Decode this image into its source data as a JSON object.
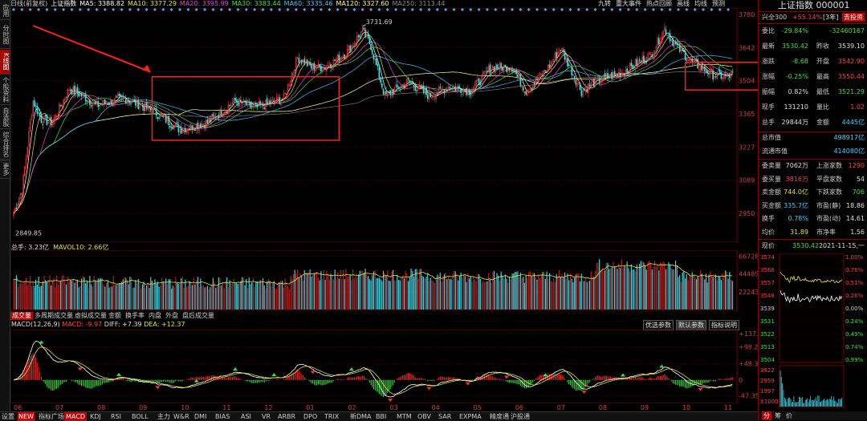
{
  "left_toolbar": [
    "应用",
    "分时图",
    "K线图",
    "个股资料",
    "自选股",
    "综合排名",
    "牛叉诊断",
    "更多"
  ],
  "legend": {
    "period": "日线(前复权)",
    "index_name": "上证指数",
    "ma5": "MA5: 3388.82",
    "ma10": "MA10: 3377.29",
    "ma20": "MA20: 3395.99",
    "ma30": "MA30: 3383.44",
    "ma60": "MA60: 3335.46",
    "ma120": "MA120: 3327.60",
    "ma250": "MA250: 3113.44"
  },
  "top_links": [
    "九转",
    "重大事件",
    "热点回顾",
    "画线",
    "均线",
    "预测"
  ],
  "price_axis": [
    "3780",
    "3642",
    "3504",
    "3365",
    "3227",
    "3089",
    "2950"
  ],
  "peak_label": "3731.69",
  "low_label": "2849.85",
  "volume": {
    "label": "总手: 3.23亿",
    "mavol": "MAVOL10: 2.66亿",
    "axis": [
      "66728",
      "44485",
      "22243"
    ]
  },
  "vol_tabs": [
    "成交量",
    "多周期成交量",
    "虚拟成交量",
    "金额",
    "换手率",
    "内盘",
    "外盘",
    "盘后成交量"
  ],
  "macd": {
    "label": "MACD(12,26,9)",
    "macd": "MACD: -9.97",
    "diff": "DIFF: +7.39",
    "dea": "DEA: +12.37",
    "axis": [
      "+137.9",
      "+98.29",
      "+48.35",
      "0",
      "-47.35"
    ],
    "buttons": [
      "优选参数",
      "默认参数",
      "指标说明"
    ]
  },
  "months": [
    "06",
    "07",
    "08",
    "09",
    "10",
    "11",
    "12",
    "01",
    "02",
    "03",
    "04",
    "05",
    "06",
    "07",
    "08",
    "09",
    "10",
    "11"
  ],
  "bottom_tabs": [
    "设置",
    "NEW",
    "指标广场",
    "MACD",
    "KDJ",
    "RSI",
    "BOLL",
    "主力",
    "W&R",
    "DMI",
    "BIAS",
    "ASI",
    "VR",
    "ARBR",
    "DPO",
    "TRIX",
    "新DMA",
    "BBI",
    "MTM",
    "OBV",
    "SAR",
    "EXPMA",
    "精度通",
    "沪股通"
  ],
  "right_panel": {
    "title": "上证指数 000001",
    "hs300_label": "兴全300",
    "hs300_val": "+55.14%",
    "hs300_tag": "[3年]",
    "hs300_btn": "去投资",
    "rows": [
      {
        "l": "委比",
        "v1": "-29.84%",
        "c1": "grn",
        "l2": "",
        "v2": "-32460167",
        "c2": "grn"
      },
      {
        "l": "最新",
        "v1": "3530.42",
        "c1": "grn",
        "l2": "昨收",
        "v2": "3539.10",
        "c2": "wht"
      },
      {
        "l": "涨跌",
        "v1": "-8.68",
        "c1": "grn",
        "l2": "开盘",
        "v2": "3542.90",
        "c2": "red"
      },
      {
        "l": "涨幅",
        "v1": "-0.25%",
        "c1": "grn",
        "l2": "最高",
        "v2": "3550.44",
        "c2": "red"
      },
      {
        "l": "振幅",
        "v1": "0.82%",
        "c1": "wht",
        "l2": "最低",
        "v2": "3521.29",
        "c2": "grn"
      },
      {
        "l": "现手",
        "v1": "131210",
        "c1": "wht",
        "l2": "量比",
        "v2": "1.02",
        "c2": "red"
      },
      {
        "l": "总手",
        "v1": "29844万",
        "c1": "wht",
        "l2": "金额",
        "v2": "4445亿",
        "c2": "cyan"
      }
    ],
    "mktcap_label": "总市值",
    "mktcap": "498917亿",
    "float_label": "流通市值",
    "float": "414080亿",
    "rows2": [
      {
        "l": "委卖量",
        "v1": "7062万",
        "c1": "wht",
        "l2": "上涨家数",
        "v2": "1290",
        "c2": "red"
      },
      {
        "l": "委买量",
        "v1": "3816万",
        "c1": "red",
        "l2": "平盘家数",
        "v2": "54",
        "c2": "wht"
      },
      {
        "l": "卖金额",
        "v1": "744.0亿",
        "c1": "yel",
        "l2": "下跌家数",
        "v2": "706",
        "c2": "grn"
      },
      {
        "l": "买金额",
        "v1": "335.7亿",
        "c1": "cyan",
        "l2": "市盈(静)",
        "v2": "18.86",
        "c2": "wht"
      },
      {
        "l": "换手",
        "v1": "0.78%",
        "c1": "cyan",
        "l2": "市盈(动)",
        "v2": "14.61",
        "c2": "wht"
      },
      {
        "l": "均价",
        "v1": "31.89",
        "c1": "yel",
        "l2": "市净率",
        "v2": "1.56",
        "c2": "wht"
      }
    ],
    "now_label": "现价",
    "now_val": "3530.42",
    "now_date": "2021-11-15,一",
    "mini_left": [
      "3574",
      "3566",
      "3557",
      "3548",
      "3539",
      "3531",
      "3522",
      "3513",
      "3504"
    ],
    "mini_right": [
      "1.00%",
      "0.76%",
      "0.51%",
      "0.26%",
      "0.00%",
      "0.24%",
      "0.49%",
      "0.74%",
      "0.99%"
    ],
    "mini_vol": [
      "3922",
      "2959",
      "1997",
      "X1000"
    ],
    "bottom_tabs": [
      "分",
      "筹",
      "价"
    ]
  }
}
